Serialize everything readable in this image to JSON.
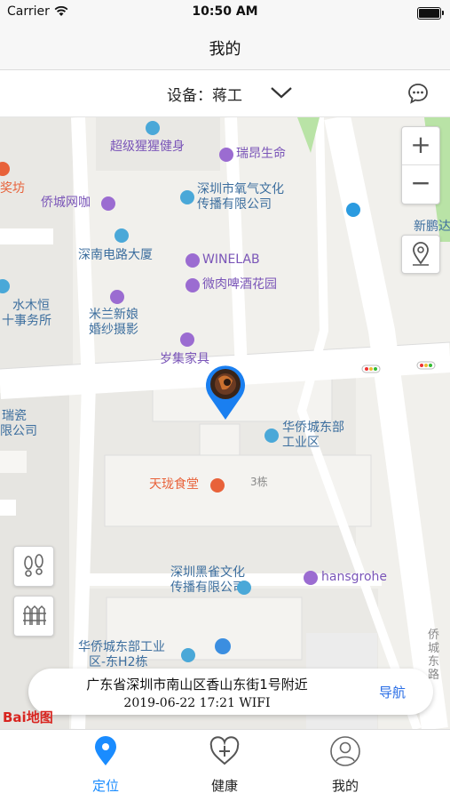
{
  "status": {
    "carrier": "Carrier",
    "time": "10:50 AM"
  },
  "nav": {
    "title": "我的"
  },
  "device": {
    "label": "设备：蒋工"
  },
  "map": {
    "pois": [
      {
        "name": "超级猩猩健身",
        "color": "purple"
      },
      {
        "name": "瑞昂生命",
        "color": "purple"
      },
      {
        "name": "侨城网咖",
        "color": "purple"
      },
      {
        "name": "深圳市氧气文化",
        "color": "blue"
      },
      {
        "name": "传播有限公司",
        "color": "blue"
      },
      {
        "name": "深南电路大厦",
        "color": "blue"
      },
      {
        "name": "WINELAB",
        "color": "purple"
      },
      {
        "name": "微肉啤酒花园",
        "color": "purple"
      },
      {
        "name": "米兰新娘",
        "color": "blue"
      },
      {
        "name": "婚纱摄影",
        "color": "blue"
      },
      {
        "name": "岁集家具",
        "color": "purple"
      },
      {
        "name": "华侨城东部",
        "color": "blue"
      },
      {
        "name": "工业区",
        "color": "blue"
      },
      {
        "name": "天珑食堂",
        "color": "orange"
      },
      {
        "name": "3栋",
        "color": "gray"
      },
      {
        "name": "深圳黑雀文化",
        "color": "blue"
      },
      {
        "name": "传播有限公司",
        "color": "blue"
      },
      {
        "name": "hansgrohe",
        "color": "purple"
      },
      {
        "name": "华侨城东部工业",
        "color": "blue"
      },
      {
        "name": "区-东H2栋",
        "color": "blue"
      },
      {
        "name": "水木恒",
        "color": "blue"
      },
      {
        "name": "十事务所",
        "color": "blue"
      },
      {
        "name": "瑞瓷",
        "color": "blue"
      },
      {
        "name": "限公司",
        "color": "blue"
      },
      {
        "name": "奖坊",
        "color": "orange"
      },
      {
        "name": "新鹏达",
        "color": "blue"
      },
      {
        "name": "侨城东路",
        "color": "gray"
      }
    ],
    "zoom_in": "+",
    "zoom_out": "−",
    "logo": "Bai地图"
  },
  "location": {
    "address": "广东省深圳市南山区香山东街1号附近",
    "timestamp": "2019-06-22 17:21 WIFI",
    "nav_label": "导航"
  },
  "tabs": [
    {
      "label": "定位",
      "icon": "location-pin-icon",
      "active": true
    },
    {
      "label": "健康",
      "icon": "heart-plus-icon",
      "active": false
    },
    {
      "label": "我的",
      "icon": "person-icon",
      "active": false
    }
  ],
  "colors": {
    "accent": "#1a8cff",
    "nav_link": "#2a6ee6",
    "pin": "#1a7ff0"
  }
}
